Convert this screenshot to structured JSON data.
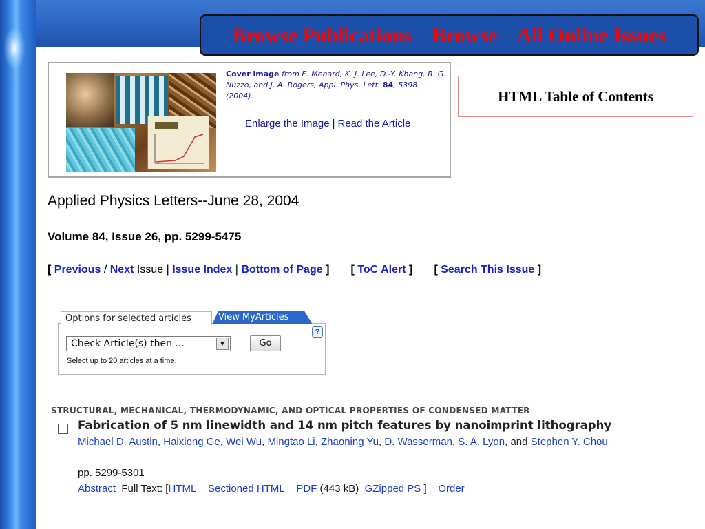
{
  "slide_title": "Browse Publications – Browse – All Online Issues",
  "cover": {
    "label": "Cover image",
    "caption_pre": "from E. Menard, K. J. Lee, D.-Y. Khang, R. G. Nuzzo, and J. A. Rogers, Appl. Phys. Lett.",
    "volume": "84",
    "caption_post": ", 5398 (2004).",
    "enlarge_link": "Enlarge the Image",
    "separator": "|",
    "read_link": "Read the Article"
  },
  "html_toc_label": "HTML Table of Contents",
  "journal_title": "Applied Physics Letters--June 28, 2004",
  "volume_line": "Volume 84, Issue 26, pp. 5299-5475",
  "nav": {
    "open1": "[",
    "previous": "Previous",
    "slash": "/",
    "next": "Next",
    "issue_word": "Issue",
    "sep1": "|",
    "issue_index": "Issue Index",
    "sep2": "|",
    "bottom": "Bottom of Page",
    "close1": "]",
    "open2": "[",
    "toc_alert": "ToC Alert",
    "close2": "]",
    "open3": "[",
    "search_issue": "Search This Issue",
    "close3": "]"
  },
  "options": {
    "tab_label": "Options for selected articles",
    "myarticles_tab": "View MyArticles",
    "help": "?",
    "select_value": "Check Article(s) then ...",
    "select_arrow": "▼",
    "go_label": "Go",
    "note": "Select up to 20 articles at a time."
  },
  "article": {
    "section": "STRUCTURAL, MECHANICAL, THERMODYNAMIC, AND OPTICAL PROPERTIES OF CONDENSED MATTER",
    "title": "Fabrication of 5  nm linewidth and 14  nm pitch features by nanoimprint lithography",
    "authors": [
      "Michael D. Austin",
      "Haixiong Ge",
      "Wei Wu",
      "Mingtao Li",
      "Zhaoning Yu",
      "D. Wasserman",
      "S. A. Lyon"
    ],
    "and_word": "and",
    "last_author": "Stephen Y. Chou",
    "pages": "pp. 5299-5301",
    "abstract": "Abstract",
    "full_text_label": "Full Text: [",
    "html": "HTML",
    "sectioned_html": "Sectioned HTML",
    "pdf": "PDF",
    "pdf_size": "(443 kB)",
    "gzipped": "GZipped PS",
    "close_bracket": "]",
    "order": "Order"
  }
}
